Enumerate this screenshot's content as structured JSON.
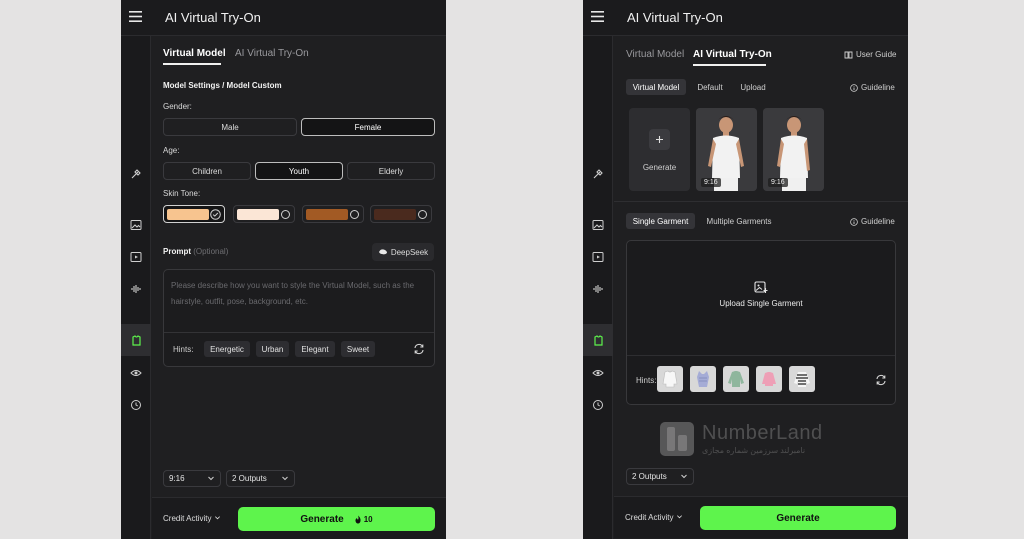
{
  "app": {
    "title": "AI Virtual Try-On"
  },
  "left": {
    "tabs": [
      "Virtual Model",
      "AI Virtual Try-On"
    ],
    "section_title": "Model Settings / Model Custom",
    "gender": {
      "label": "Gender:",
      "options": [
        "Male",
        "Female"
      ],
      "selected": "Female"
    },
    "age": {
      "label": "Age:",
      "options": [
        "Children",
        "Youth",
        "Elderly"
      ],
      "selected": "Youth"
    },
    "skin_tone": {
      "label": "Skin Tone:",
      "colors": [
        "#f7c48f",
        "#fbe6d6",
        "#a25a24",
        "#4a2a1e"
      ],
      "selected_index": 0
    },
    "prompt": {
      "label": "Prompt",
      "optional": "(Optional)",
      "deepseek": "DeepSeek",
      "placeholder": "Please describe how you want to style the Virtual Model, such as the hairstyle, outfit, pose, background, etc."
    },
    "hints": {
      "label": "Hints:",
      "items": [
        "Energetic",
        "Urban",
        "Elegant",
        "Sweet"
      ]
    },
    "ratio": "9:16",
    "outputs": "2 Outputs",
    "footer": {
      "credit": "Credit Activity",
      "generate": "Generate",
      "cost": "10"
    }
  },
  "right": {
    "tabs": [
      "Virtual Model",
      "AI Virtual Try-On"
    ],
    "user_guide": "User Guide",
    "model_tabs": [
      "Virtual Model",
      "Default",
      "Upload"
    ],
    "guideline": "Guideline",
    "generate_tile": "Generate",
    "thumb_ratio": "9:16",
    "garment_tabs": [
      "Single Garment",
      "Multiple Garments"
    ],
    "upload_label": "Upload Single Garment",
    "hints_label": "Hints:",
    "outputs": "2 Outputs",
    "footer": {
      "credit": "Credit Activity",
      "generate": "Generate"
    }
  },
  "watermark": {
    "brand": "NumberLand",
    "tagline": "نامبرلند سرزمین شماره مجازی"
  },
  "colors": {
    "accent_green": "#5ef44c",
    "bg": "#1f1f21"
  }
}
